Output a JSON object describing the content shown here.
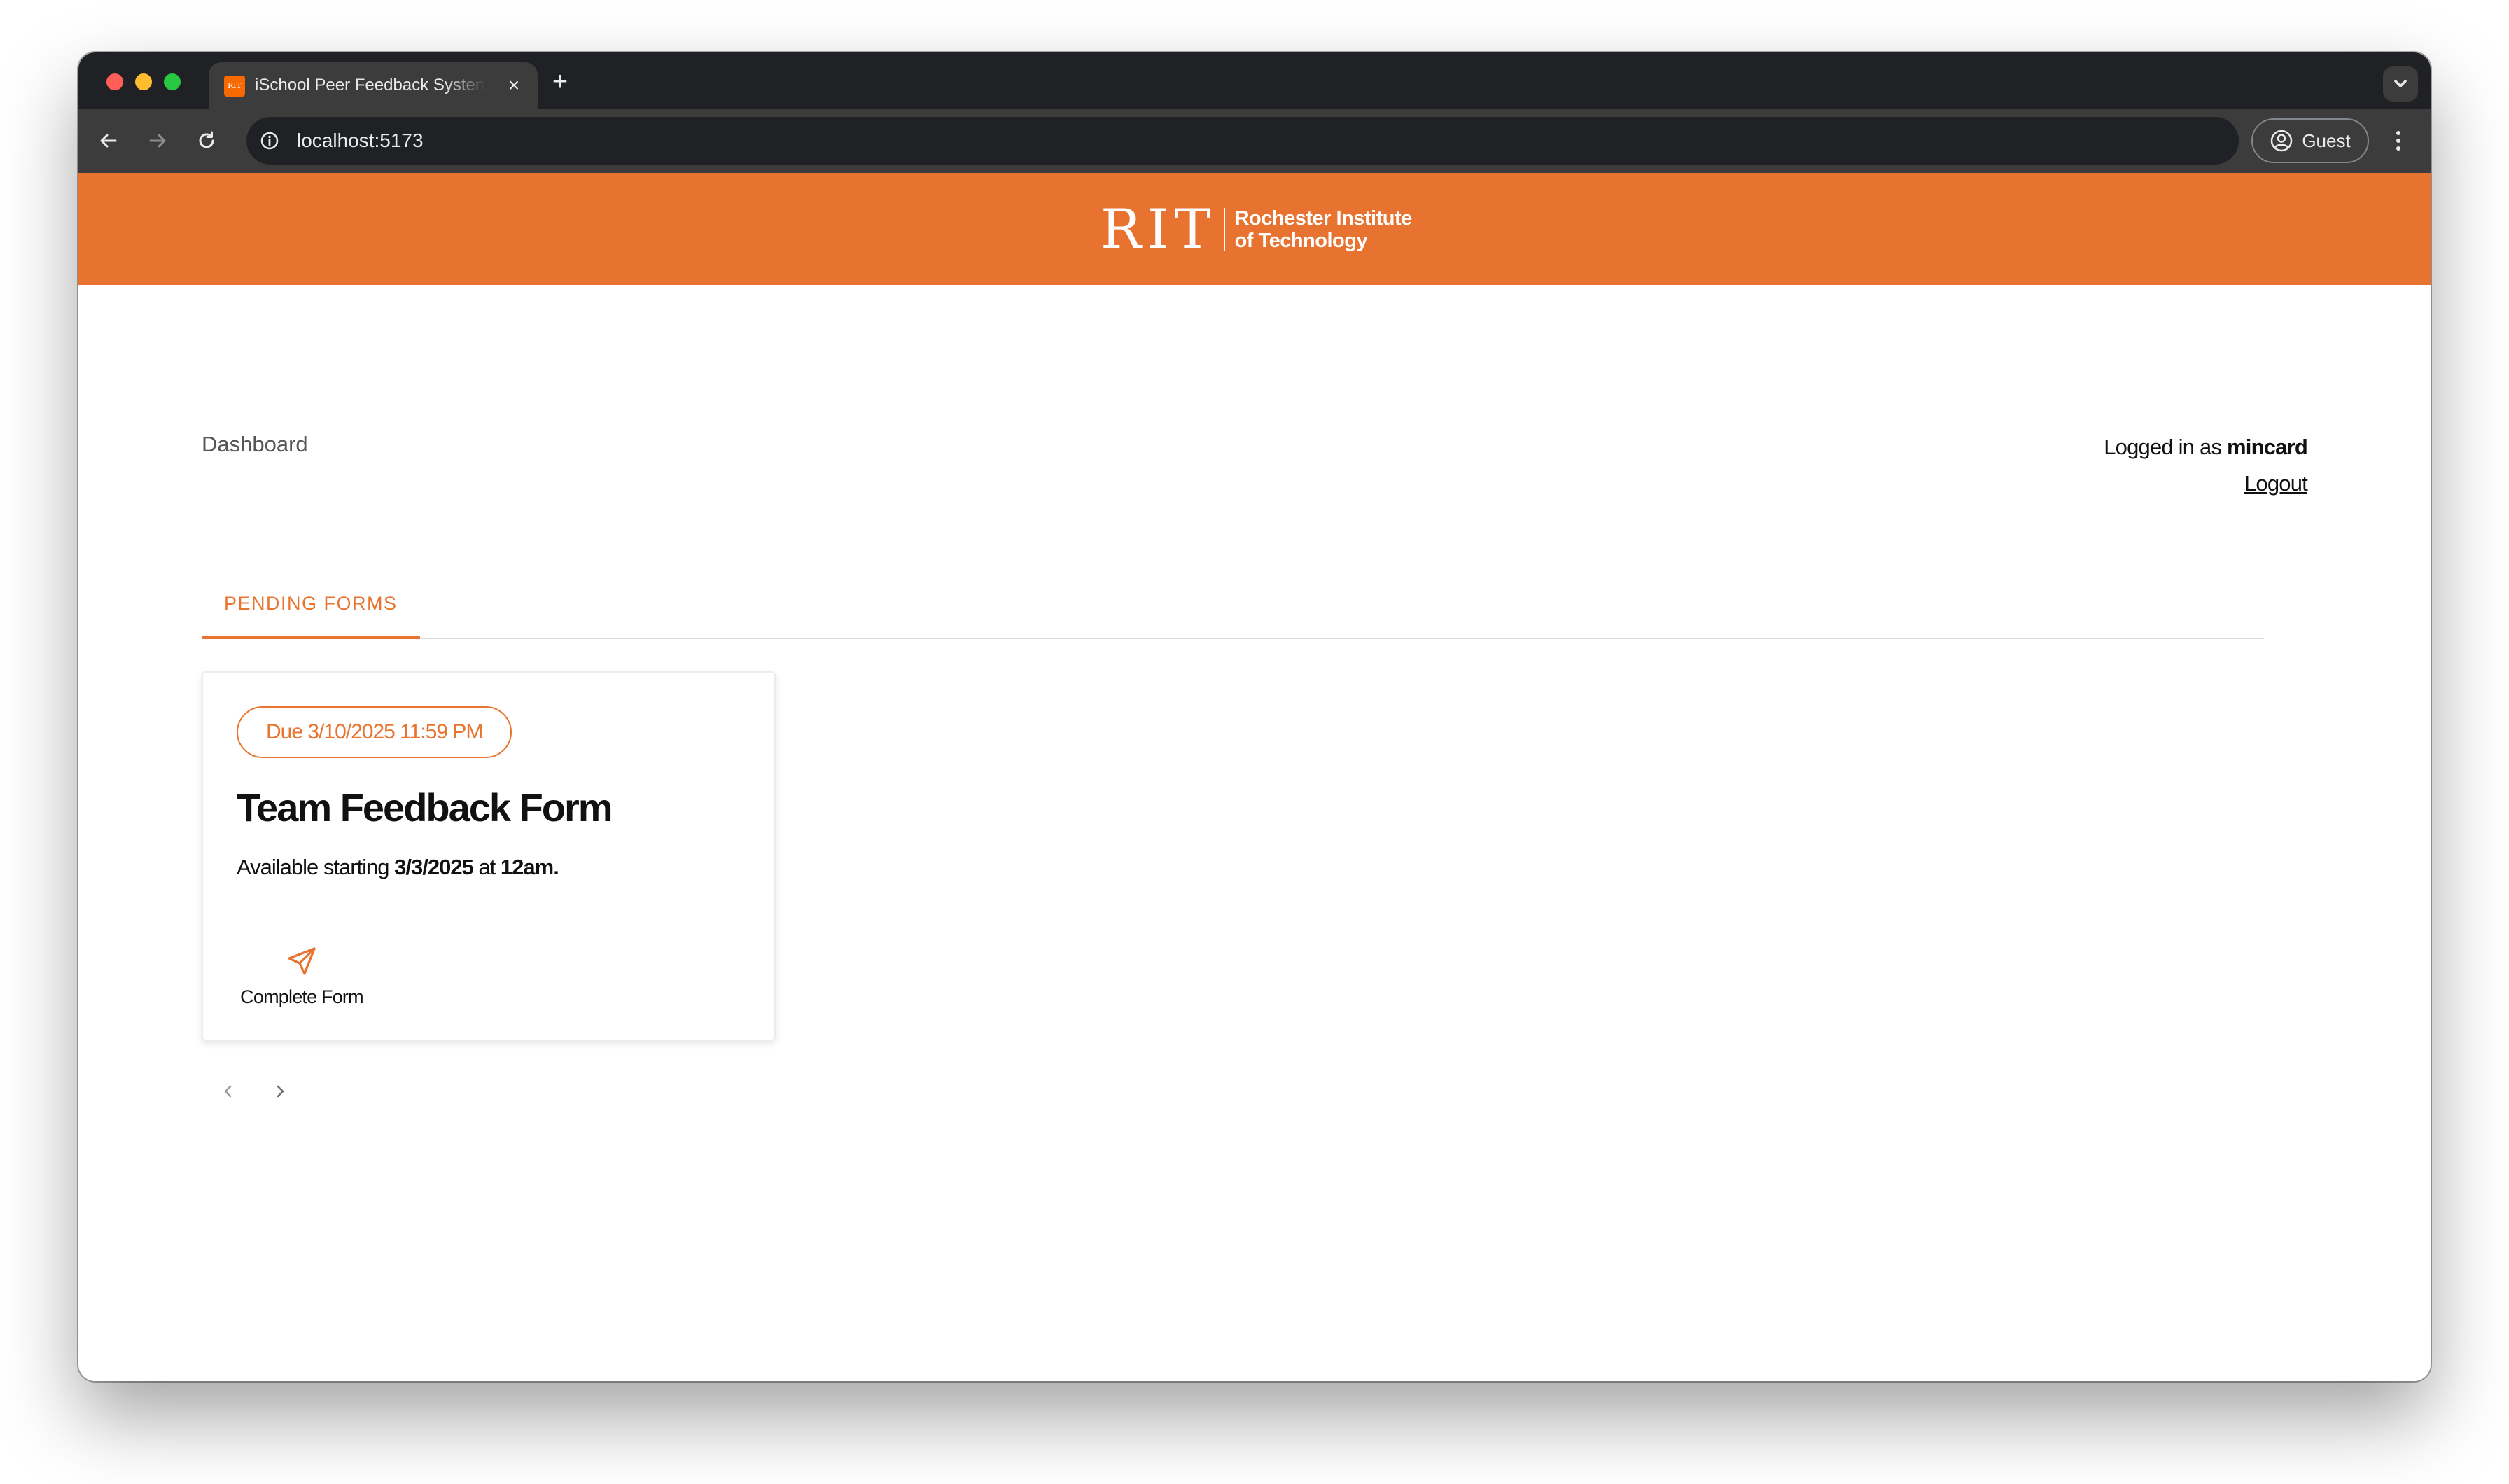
{
  "browser": {
    "tab_title": "iSchool Peer Feedback System",
    "tab_favicon": "RIT",
    "tab_close_icon": "close-icon",
    "url": "localhost:5173",
    "profile_label": "Guest"
  },
  "site_header": {
    "logo_mark": "RIT",
    "logo_line1": "Rochester Institute",
    "logo_line2": "of Technology",
    "brand_color": "#e87330"
  },
  "page": {
    "breadcrumb": "Dashboard",
    "user": {
      "prefix": "Logged in as",
      "username": "mincard",
      "logout_label": "Logout"
    },
    "tabs": [
      {
        "label": "PENDING FORMS",
        "active": true
      }
    ],
    "form_card": {
      "due_badge": "Due 3/10/2025 11:59 PM",
      "title": "Team Feedback Form",
      "available_prefix": "Available starting",
      "available_date": "3/3/2025",
      "available_mid": "at",
      "available_time": "12am.",
      "action_icon": "send-icon",
      "action_label": "Complete Form"
    },
    "pager": {
      "prev_icon": "chevron-left-icon",
      "next_icon": "chevron-right-icon"
    }
  },
  "colors": {
    "accent": "#e8742f",
    "chrome_dark": "#202124",
    "chrome_toolbar": "#3c3c3c"
  }
}
